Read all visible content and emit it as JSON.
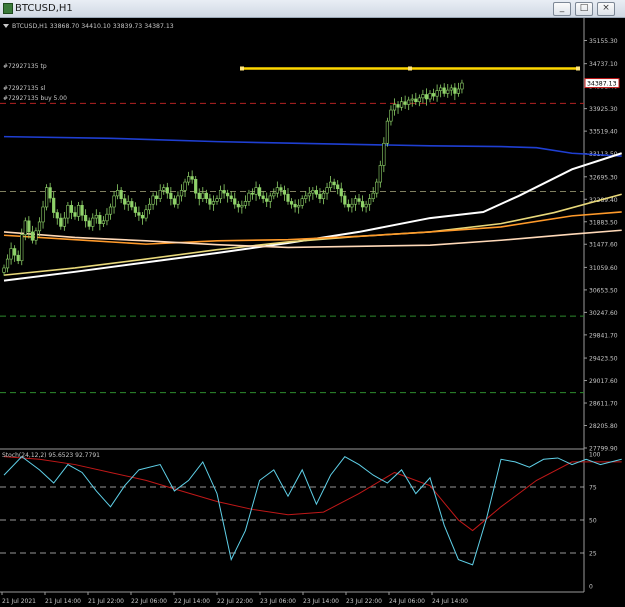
{
  "window": {
    "title": "BTCUSD,H1",
    "minimize_glyph": "_",
    "maximize_glyph": "□",
    "close_glyph": "×"
  },
  "chart_data": [
    {
      "type": "candlestick",
      "symbol_line": "BTCUSD,H1  33868.70 34410.10 33839.73 34387.13",
      "current_price": "34387.13",
      "ylim": [
        27799.9,
        35561.3
      ],
      "y_ticks": [
        "35155.30",
        "34737.10",
        "34331.40",
        "33925.30",
        "33519.40",
        "33113.50",
        "32695.30",
        "32289.40",
        "31883.50",
        "31477.60",
        "31059.60",
        "30653.50",
        "30247.60",
        "29841.70",
        "29423.50",
        "29017.60",
        "28611.70",
        "28205.80",
        "27799.90"
      ],
      "x_ticks": [
        "21 Jul 2021",
        "21 Jul 14:00",
        "21 Jul 22:00",
        "22 Jul 06:00",
        "22 Jul 14:00",
        "22 Jul 22:00",
        "23 Jul 06:00",
        "23 Jul 14:00",
        "23 Jul 22:00",
        "24 Jul 06:00",
        "24 Jul 14:00"
      ],
      "orders": [
        {
          "label": "#72927135 tp",
          "price": 34650
        },
        {
          "label": "#72927135 sl",
          "price": 34300
        },
        {
          "label": "#72927135 buy 5.00",
          "price": 34180
        }
      ],
      "levels": [
        {
          "price": 34650,
          "color": "#ffd700",
          "style": "solid"
        },
        {
          "price": 34020,
          "color": "#b22222",
          "style": "dash"
        },
        {
          "price": 32430,
          "color": "#808060",
          "style": "dash"
        },
        {
          "price": 30180,
          "color": "#2e8b2e",
          "style": "dash"
        },
        {
          "price": 28800,
          "color": "#2e8b2e",
          "style": "dash"
        }
      ],
      "close": [
        31050,
        31210,
        31400,
        31280,
        31180,
        31650,
        31900,
        31700,
        31550,
        31720,
        31880,
        32150,
        32500,
        32310,
        32050,
        31950,
        31800,
        31950,
        32180,
        32050,
        31980,
        32180,
        32000,
        31900,
        31800,
        31950,
        32000,
        31850,
        31900,
        32020,
        32150,
        32350,
        32450,
        32300,
        32200,
        32250,
        32150,
        32050,
        32000,
        31950,
        32100,
        32200,
        32350,
        32300,
        32450,
        32500,
        32400,
        32300,
        32200,
        32350,
        32450,
        32600,
        32700,
        32650,
        32400,
        32300,
        32400,
        32300,
        32200,
        32250,
        32300,
        32450,
        32400,
        32350,
        32300,
        32200,
        32150,
        32180,
        32250,
        32400,
        32380,
        32500,
        32350,
        32300,
        32250,
        32350,
        32400,
        32500,
        32450,
        32380,
        32250,
        32200,
        32150,
        32180,
        32300,
        32350,
        32400,
        32450,
        32380,
        32300,
        32400,
        32500,
        32600,
        32550,
        32480,
        32350,
        32200,
        32150,
        32200,
        32300,
        32250,
        32150,
        32200,
        32300,
        32400,
        32600,
        32900,
        33300,
        33700,
        33900,
        34000,
        33950,
        34050,
        34000,
        34080,
        34100,
        34050,
        34120,
        34180,
        34100,
        34200,
        34150,
        34250,
        34300,
        34200,
        34260,
        34300,
        34200,
        34280,
        34387
      ],
      "series": [
        {
          "name": "blue",
          "color": "#1f3fd2",
          "points": [
            [
              0,
              33420
            ],
            [
              30,
              33390
            ],
            [
              60,
              33330
            ],
            [
              90,
              33290
            ],
            [
              120,
              33255
            ],
            [
              140,
              33240
            ],
            [
              150,
              33220
            ],
            [
              160,
              33120
            ],
            [
              174,
              33070
            ]
          ]
        },
        {
          "name": "white",
          "color": "#ffffff",
          "points": [
            [
              0,
              30820
            ],
            [
              20,
              30980
            ],
            [
              40,
              31150
            ],
            [
              60,
              31320
            ],
            [
              80,
              31500
            ],
            [
              100,
              31700
            ],
            [
              120,
              31950
            ],
            [
              135,
              32060
            ],
            [
              145,
              32350
            ],
            [
              160,
              32830
            ],
            [
              174,
              33120
            ]
          ]
        },
        {
          "name": "khaki",
          "color": "#e8d87a",
          "points": [
            [
              0,
              30920
            ],
            [
              20,
              31050
            ],
            [
              40,
              31210
            ],
            [
              60,
              31380
            ],
            [
              80,
              31520
            ],
            [
              100,
              31620
            ],
            [
              120,
              31700
            ],
            [
              140,
              31850
            ],
            [
              155,
              32050
            ],
            [
              174,
              32380
            ]
          ]
        },
        {
          "name": "orange",
          "color": "#ff9a2a",
          "points": [
            [
              0,
              31640
            ],
            [
              20,
              31560
            ],
            [
              40,
              31480
            ],
            [
              60,
              31540
            ],
            [
              80,
              31560
            ],
            [
              100,
              31620
            ],
            [
              120,
              31700
            ],
            [
              140,
              31790
            ],
            [
              160,
              31990
            ],
            [
              174,
              32060
            ]
          ]
        },
        {
          "name": "light",
          "color": "#ffd9b8",
          "points": [
            [
              0,
              31700
            ],
            [
              20,
              31600
            ],
            [
              40,
              31540
            ],
            [
              60,
              31470
            ],
            [
              80,
              31420
            ],
            [
              100,
              31440
            ],
            [
              120,
              31460
            ],
            [
              140,
              31550
            ],
            [
              160,
              31660
            ],
            [
              174,
              31730
            ]
          ]
        }
      ],
      "stoch": {
        "label": "Stoch(24,12,2) 95.6523 92.7791",
        "ylim": [
          0,
          100
        ],
        "y_ticks": [
          "100",
          "75",
          "50",
          "25",
          "0"
        ],
        "main": [
          [
            0,
            84
          ],
          [
            5,
            98
          ],
          [
            10,
            88
          ],
          [
            14,
            78
          ],
          [
            18,
            92
          ],
          [
            22,
            86
          ],
          [
            26,
            72
          ],
          [
            30,
            60
          ],
          [
            34,
            76
          ],
          [
            38,
            88
          ],
          [
            44,
            92
          ],
          [
            48,
            72
          ],
          [
            52,
            80
          ],
          [
            56,
            94
          ],
          [
            60,
            70
          ],
          [
            64,
            20
          ],
          [
            68,
            42
          ],
          [
            72,
            80
          ],
          [
            76,
            88
          ],
          [
            80,
            68
          ],
          [
            84,
            88
          ],
          [
            88,
            62
          ],
          [
            92,
            84
          ],
          [
            96,
            98
          ],
          [
            100,
            92
          ],
          [
            104,
            84
          ],
          [
            108,
            78
          ],
          [
            112,
            88
          ],
          [
            116,
            70
          ],
          [
            120,
            82
          ],
          [
            124,
            46
          ],
          [
            128,
            20
          ],
          [
            132,
            16
          ],
          [
            136,
            52
          ],
          [
            140,
            96
          ],
          [
            144,
            94
          ],
          [
            148,
            90
          ],
          [
            152,
            96
          ],
          [
            156,
            97
          ],
          [
            160,
            92
          ],
          [
            164,
            96
          ],
          [
            168,
            92
          ],
          [
            174,
            96
          ]
        ],
        "signal": [
          [
            0,
            98
          ],
          [
            10,
            96
          ],
          [
            20,
            92
          ],
          [
            30,
            86
          ],
          [
            40,
            80
          ],
          [
            50,
            72
          ],
          [
            60,
            64
          ],
          [
            70,
            58
          ],
          [
            80,
            54
          ],
          [
            90,
            56
          ],
          [
            100,
            70
          ],
          [
            110,
            86
          ],
          [
            120,
            76
          ],
          [
            128,
            50
          ],
          [
            132,
            42
          ],
          [
            140,
            60
          ],
          [
            150,
            80
          ],
          [
            160,
            94
          ],
          [
            174,
            94
          ]
        ]
      }
    }
  ]
}
